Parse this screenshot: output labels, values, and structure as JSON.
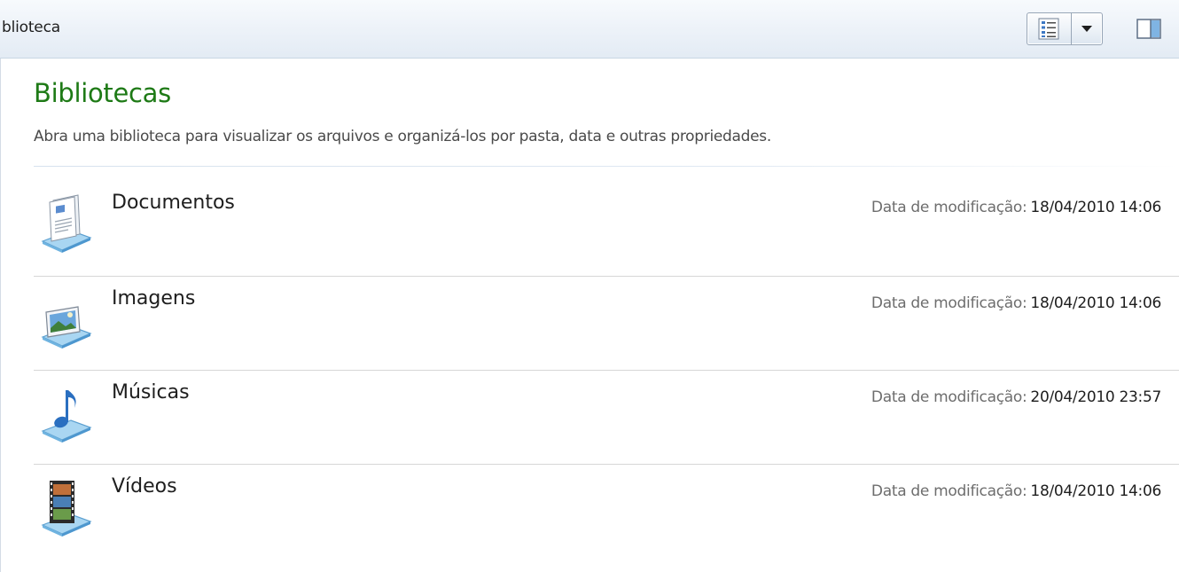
{
  "toolbar": {
    "title": "blioteca",
    "view_icon": "details-view-icon",
    "view_dropdown_icon": "chevron-down-icon",
    "preview_pane_icon": "preview-pane-icon"
  },
  "main": {
    "title": "Bibliotecas",
    "subtitle": "Abra uma biblioteca para visualizar os arquivos e organizá-los por pasta, data e outras propriedades.",
    "libraries": [
      {
        "name": "Documentos",
        "icon": "documents-library-icon",
        "modified_label": "Data de modificação:",
        "modified": "18/04/2010 14:06"
      },
      {
        "name": "Imagens",
        "icon": "pictures-library-icon",
        "modified_label": "Data de modificação:",
        "modified": "18/04/2010 14:06"
      },
      {
        "name": "Músicas",
        "icon": "music-library-icon",
        "modified_label": "Data de modificação:",
        "modified": "20/04/2010 23:57"
      },
      {
        "name": "Vídeos",
        "icon": "videos-library-icon",
        "modified_label": "Data de modificação:",
        "modified": "18/04/2010 14:06"
      }
    ]
  },
  "colors": {
    "title_green": "#1e7a16",
    "toolbar_bg": "#e3ebf4",
    "separator": "#d6d6d6"
  }
}
